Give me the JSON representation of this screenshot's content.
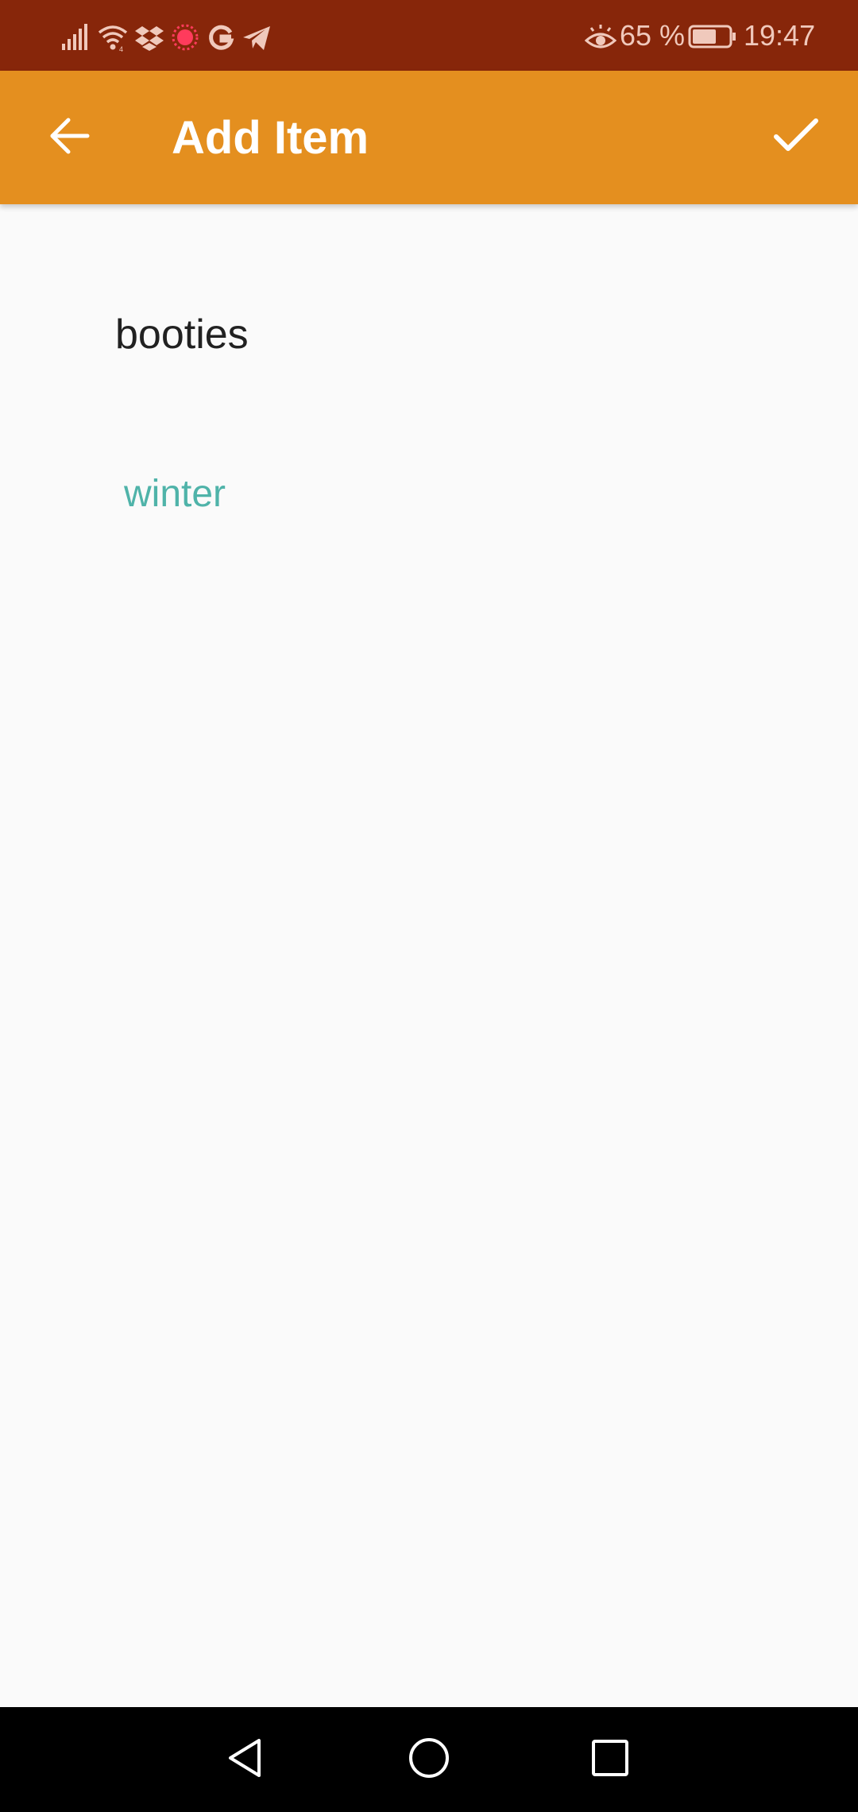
{
  "status_bar": {
    "battery_percent": "65 %",
    "time": "19:47",
    "icons": [
      "signal-icon",
      "wifi-icon",
      "dropbox-icon",
      "record-icon",
      "google-icon",
      "telegram-icon",
      "eye-comfort-icon",
      "battery-icon"
    ],
    "battery_level": 0.65
  },
  "app_bar": {
    "title": "Add Item",
    "back_icon": "arrow-back-icon",
    "confirm_icon": "check-icon"
  },
  "form": {
    "item_name": "booties",
    "category": "winter"
  },
  "nav_bar": {
    "icons": [
      "back-triangle-icon",
      "home-circle-icon",
      "recents-square-icon"
    ]
  },
  "colors": {
    "status_bar": "#87260a",
    "app_bar": "#e48f1f",
    "background": "#fafafa",
    "category_text": "#4fb3a9",
    "record_dot": "#ff3b5c"
  }
}
